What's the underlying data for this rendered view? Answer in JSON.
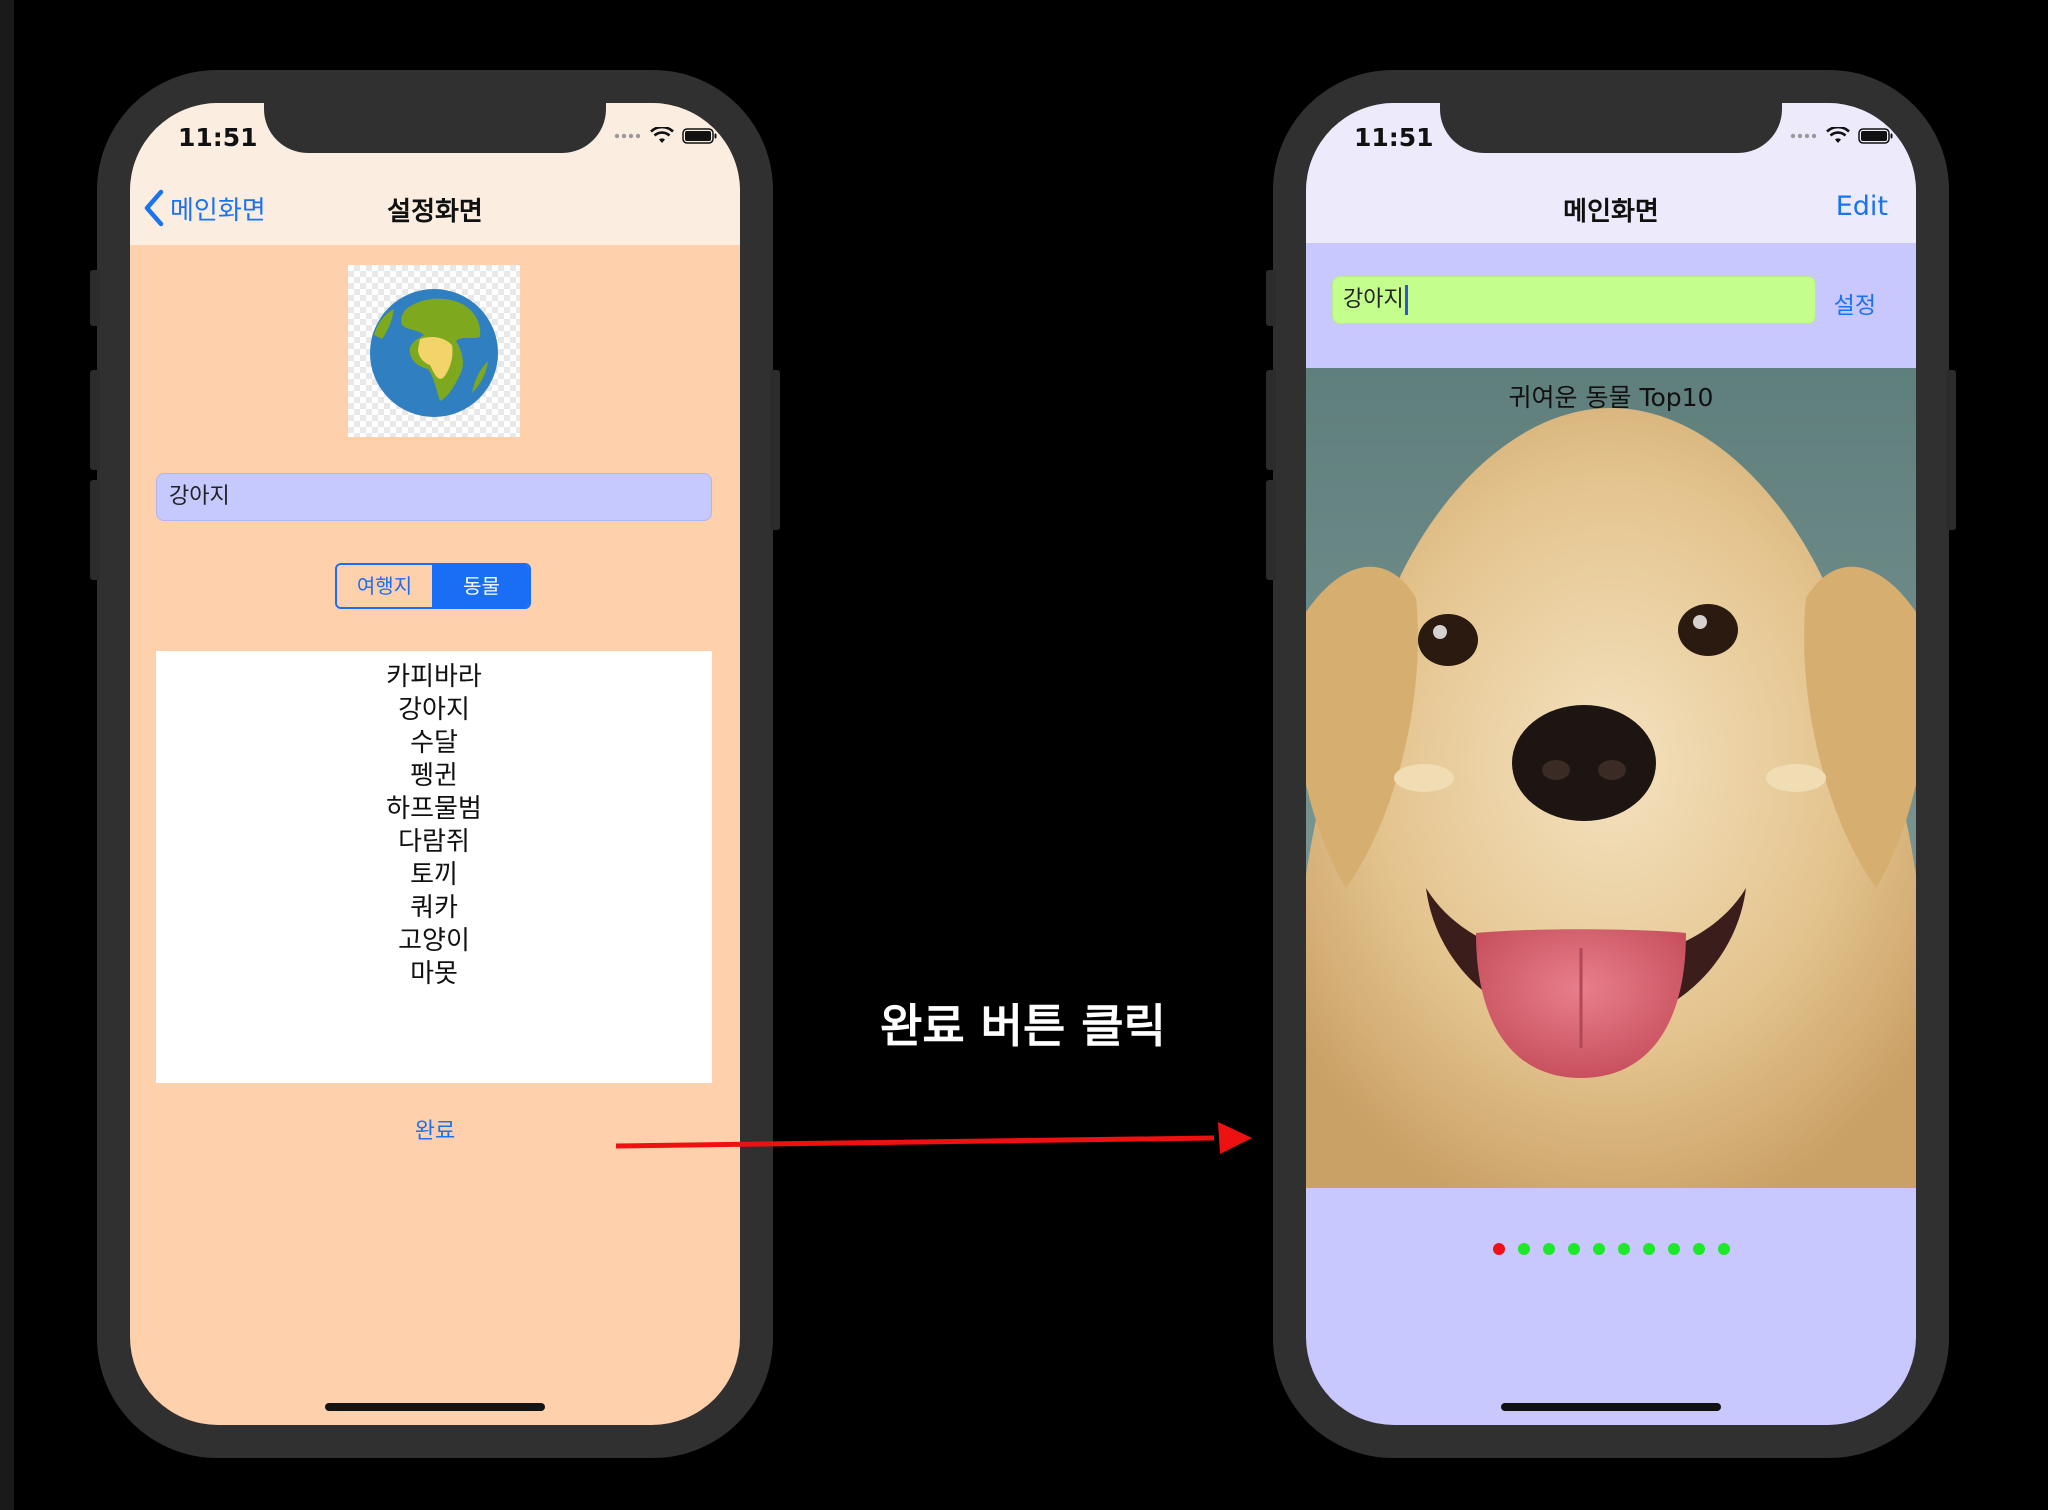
{
  "annotation": {
    "label": "완료 버튼 클릭"
  },
  "left_screen": {
    "status_time": "11:51",
    "nav": {
      "back_label": "메인화면",
      "title": "설정화면"
    },
    "text_field_value": "강아지",
    "segmented": {
      "options": [
        "여행지",
        "동물"
      ],
      "selected": "동물"
    },
    "picker_items": [
      "카피바라",
      "강아지",
      "수달",
      "펭귄",
      "하프물범",
      "다람쥐",
      "토끼",
      "쿼카",
      "고양이",
      "마못"
    ],
    "done_label": "완료"
  },
  "right_screen": {
    "status_time": "11:51",
    "nav": {
      "title": "메인화면",
      "edit_label": "Edit"
    },
    "text_field_value": "강아지",
    "settings_label": "설정",
    "caption": "귀여운 동물 Top10",
    "page_control": {
      "count": 10,
      "current_page": 1,
      "active_color": "#f0101a",
      "inactive_color": "#1ee82a"
    }
  },
  "colors": {
    "accent": "#1b73f0",
    "left_background": "#fed0ac",
    "right_background": "#c8c7fe",
    "right_field": "#c4fe8c",
    "left_field": "#c6c9fe",
    "arrow": "#ee1111"
  }
}
